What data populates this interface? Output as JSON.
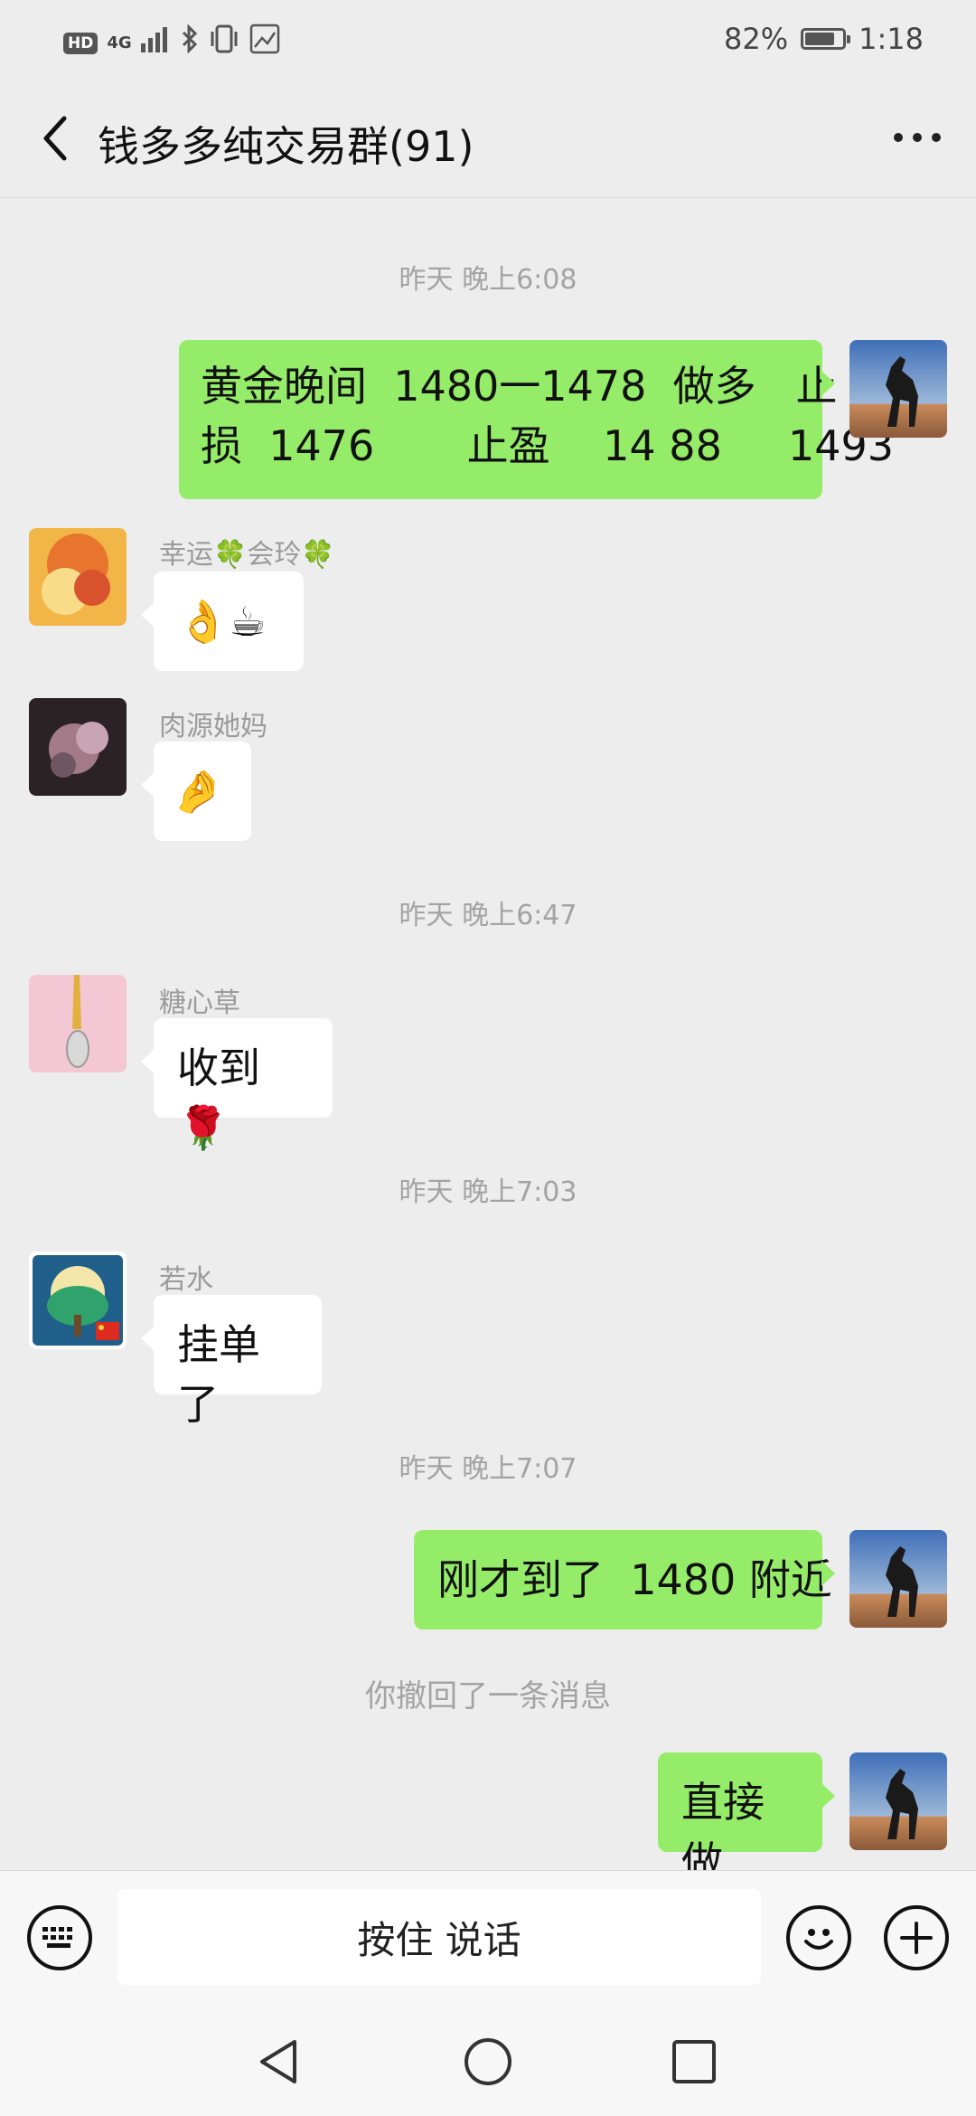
{
  "status_bar": {
    "left_icons": [
      "HD",
      "4G",
      "signal-icon",
      "bluetooth-icon",
      "vibrate-icon",
      "app-notification-icon"
    ],
    "battery": "82%",
    "battery_level": 0.82,
    "time": "1:18"
  },
  "header": {
    "title": "钱多多纯交易群(91)",
    "more_label": "···"
  },
  "timestamps": {
    "t1": "昨天 晚上6:08",
    "t2": "昨天 晚上6:47",
    "t3": "昨天 晚上7:03",
    "t4": "昨天 晚上7:07"
  },
  "messages": [
    {
      "sender": "me",
      "line1": "黄金晚间  1480一1478  做多   止",
      "line2": "损  1476       止盈    14 88     1493"
    },
    {
      "sender": "幸运🍀会玲🍀",
      "text": "👌☕"
    },
    {
      "sender": "肉源她妈",
      "text": "🤌"
    },
    {
      "sender": "糖心草",
      "text": "收到🌹"
    },
    {
      "sender": "若水",
      "text": "挂单了"
    },
    {
      "sender": "me",
      "text": "刚才到了  1480 附近"
    },
    {
      "sender": "me",
      "text": "直接做"
    }
  ],
  "system_message": "你撤回了一条消息",
  "input_bar": {
    "hold_to_talk": "按住 说话",
    "keyboard_icon": "keyboard-icon",
    "emoji_icon": "smiley-icon",
    "plus_icon": "plus-icon"
  },
  "nav_bar": {
    "back": "triangle-back-icon",
    "home": "circle-home-icon",
    "recents": "square-recents-icon"
  },
  "colors": {
    "background": "#ededed",
    "outgoing_bubble": "#95ec69",
    "incoming_bubble": "#ffffff",
    "muted_text": "#a3a3a3"
  }
}
